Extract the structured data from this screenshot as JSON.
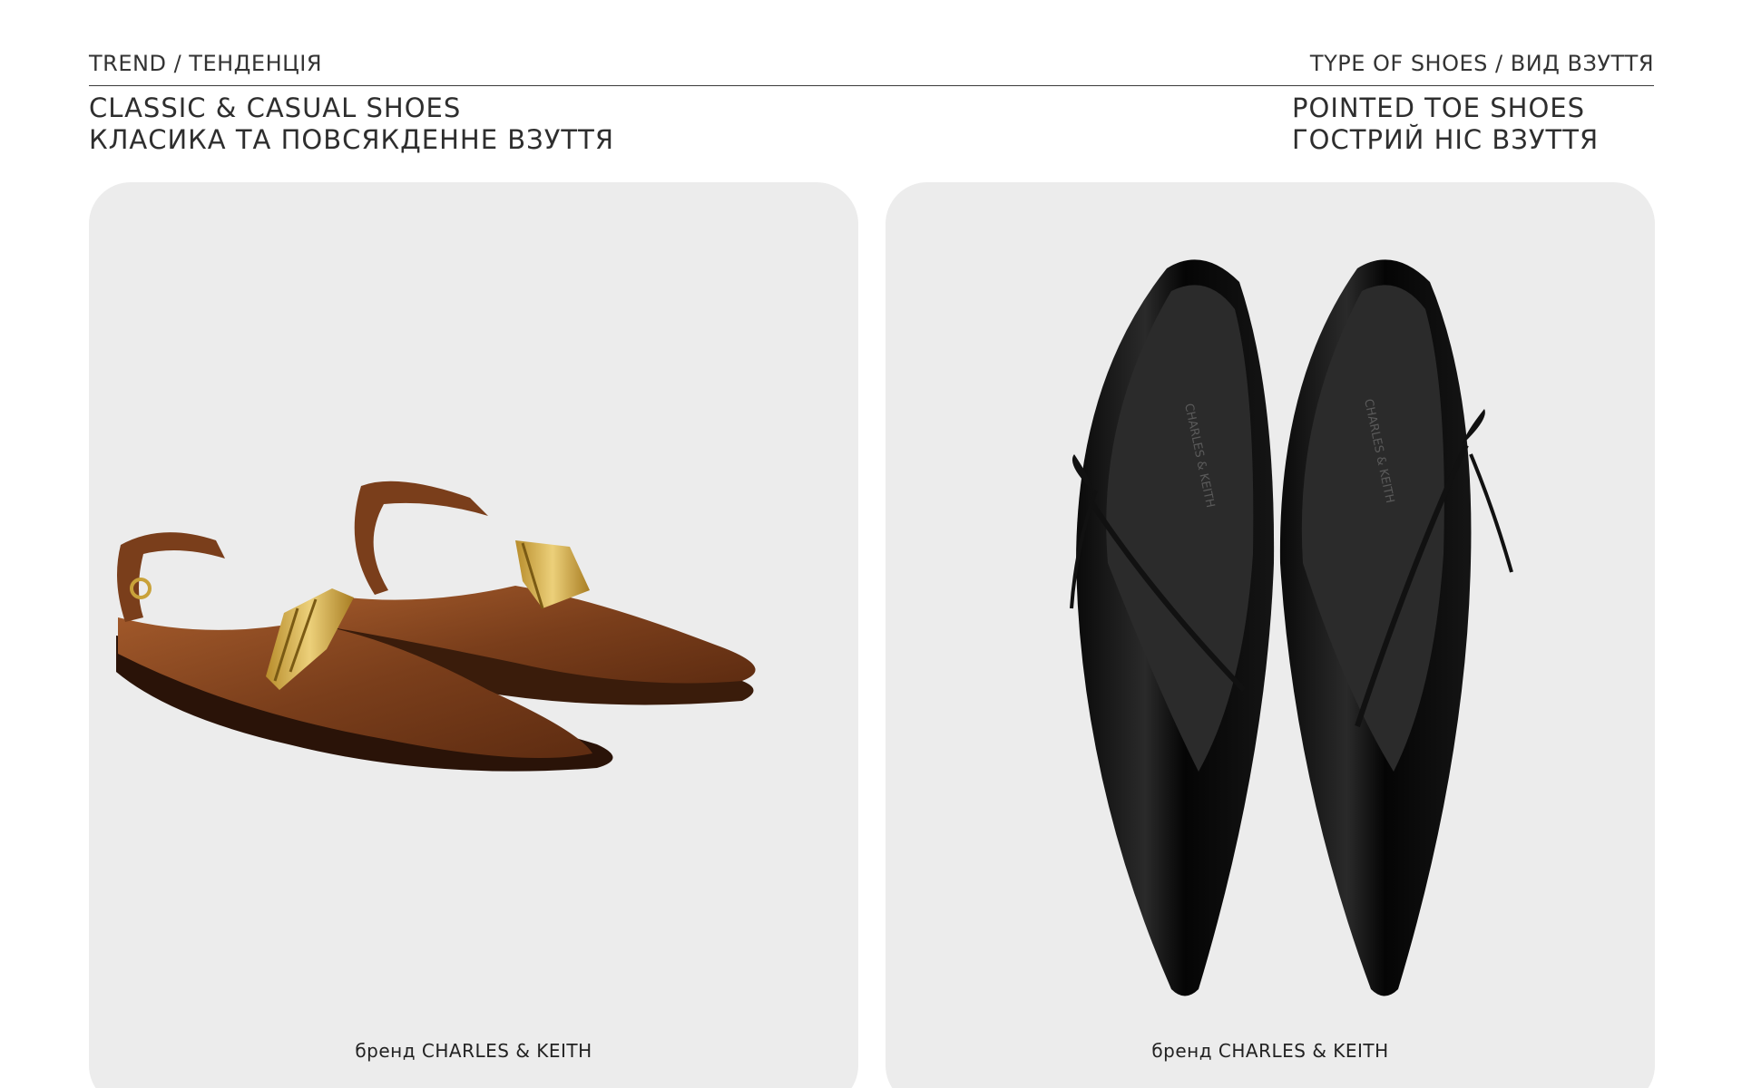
{
  "header": {
    "trend_label": "TREND / ТЕНДЕНЦІЯ",
    "type_label": "TYPE OF SHOES / ВИД ВЗУТТЯ"
  },
  "trend": {
    "title_en": "CLASSIC & CASUAL SHOES",
    "title_ua": "КЛАСИКА ТА ПОВСЯКДЕННЕ ВЗУТТЯ"
  },
  "type": {
    "title_en": "POINTED TOE SHOES",
    "title_ua": "ГОСТРИЙ НІС ВЗУТТЯ"
  },
  "cards": [
    {
      "caption": "бренд CHARLES & KEITH",
      "product_image": "brown-pointed-slingback-flats-with-gold-chain-strap",
      "colors": {
        "leather": "#8a4a22",
        "chain": "#c9a23a"
      }
    },
    {
      "caption": "бренд CHARLES & KEITH",
      "product_image": "black-pointed-flats-with-bow-strap",
      "insole_text": "CHARLES & KEITH",
      "colors": {
        "leather": "#0d0d0d"
      }
    }
  ]
}
